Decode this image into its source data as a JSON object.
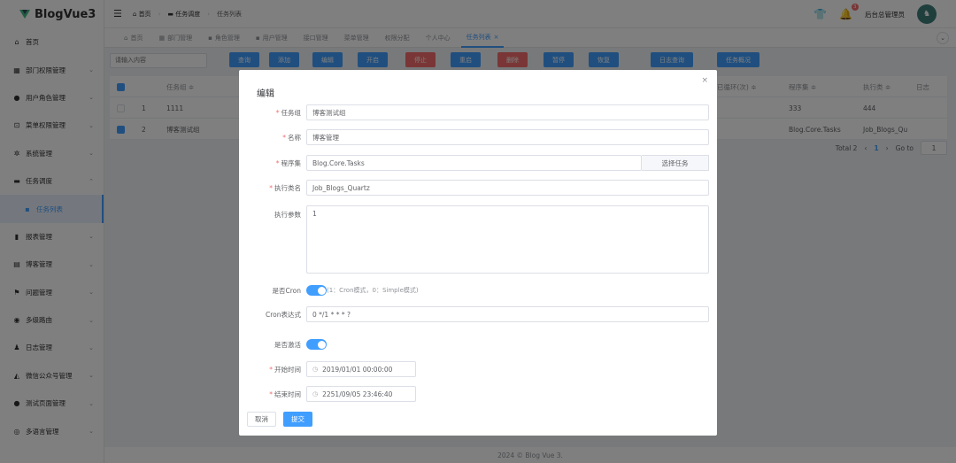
{
  "app": {
    "name": "BlogVue3"
  },
  "sidebar": {
    "items": [
      {
        "icon": "home-icon",
        "glyph": "⌂",
        "label": "首页",
        "chevron": ""
      },
      {
        "icon": "department-icon",
        "glyph": "▦",
        "label": "部门权限管理",
        "chevron": "⌄"
      },
      {
        "icon": "user-icon",
        "glyph": "●",
        "label": "用户角色管理",
        "chevron": "⌄"
      },
      {
        "icon": "lock-icon",
        "glyph": "⊡",
        "label": "菜单权限管理",
        "chevron": "⌄"
      },
      {
        "icon": "gear-icon",
        "glyph": "✲",
        "label": "系统管理",
        "chevron": "⌄"
      },
      {
        "icon": "task-icon",
        "glyph": "▬",
        "label": "任务调度",
        "chevron": "⌃"
      },
      {
        "icon": "grid-icon",
        "glyph": "▪",
        "label": "任务列表",
        "chevron": "",
        "sub": true
      },
      {
        "icon": "bar-chart-icon",
        "glyph": "▮",
        "label": "报表管理",
        "chevron": "⌄"
      },
      {
        "icon": "blog-icon",
        "glyph": "▤",
        "label": "博客管理",
        "chevron": "⌄"
      },
      {
        "icon": "flag-icon",
        "glyph": "⚑",
        "label": "问题管理",
        "chevron": "⌄"
      },
      {
        "icon": "route-icon",
        "glyph": "◉",
        "label": "多级路由",
        "chevron": "⌄"
      },
      {
        "icon": "log-icon",
        "glyph": "♟",
        "label": "日志管理",
        "chevron": "⌄"
      },
      {
        "icon": "wechat-icon",
        "glyph": "◭",
        "label": "微信公众号管理",
        "chevron": "⌄"
      },
      {
        "icon": "info-icon",
        "glyph": "●",
        "label": "测试页面管理",
        "chevron": "⌄"
      },
      {
        "icon": "language-icon",
        "glyph": "◎",
        "label": "多语言管理",
        "chevron": "⌄"
      }
    ]
  },
  "header": {
    "breadcrumb": [
      {
        "glyph": "⌂",
        "label": "首页"
      },
      {
        "glyph": "▬",
        "label": "任务调度"
      },
      {
        "glyph": "",
        "label": "任务列表"
      }
    ],
    "separator": "›",
    "notification_count": "3",
    "user_name": "后台总管理员"
  },
  "tabs": [
    {
      "glyph": "⌂",
      "label": "首页"
    },
    {
      "glyph": "▦",
      "label": "部门管理"
    },
    {
      "glyph": "▪",
      "label": "角色管理"
    },
    {
      "glyph": "▪",
      "label": "用户管理"
    },
    {
      "glyph": "",
      "label": "接口管理"
    },
    {
      "glyph": "",
      "label": "菜单管理"
    },
    {
      "glyph": "",
      "label": "权限分配"
    },
    {
      "glyph": "",
      "label": "个人中心"
    },
    {
      "glyph": "",
      "label": "任务列表",
      "active": true,
      "close": "×"
    }
  ],
  "toolbar": {
    "search_placeholder": "请输入内容",
    "buttons": [
      {
        "name": "query",
        "label": "查询",
        "color": "#409eff"
      },
      {
        "name": "add",
        "label": "添加",
        "color": "#409eff"
      },
      {
        "name": "edit",
        "label": "编辑",
        "color": "#409eff"
      },
      {
        "name": "start",
        "label": "开启",
        "color": "#409eff"
      },
      {
        "name": "stop",
        "label": "停止",
        "color": "#f56c6c"
      },
      {
        "name": "restart",
        "label": "重启",
        "color": "#409eff"
      },
      {
        "name": "delete",
        "label": "删除",
        "color": "#f56c6c"
      },
      {
        "name": "pause",
        "label": "暂停",
        "color": "#409eff"
      },
      {
        "name": "resume",
        "label": "恢复",
        "color": "#409eff"
      },
      {
        "name": "log-query",
        "label": "日志查询",
        "color": "#409eff"
      },
      {
        "name": "task-overview",
        "label": "任务概况",
        "color": "#409eff"
      }
    ]
  },
  "table": {
    "columns": [
      "任务组 ≑",
      "已循环(次) ≑",
      "程序集 ≑",
      "执行类 ≑",
      "日志"
    ],
    "rows": [
      {
        "index": "1",
        "group": "1111",
        "assembly": "333",
        "class": "444",
        "checked": false
      },
      {
        "index": "2",
        "group": "博客测试组",
        "assembly": "Blog.Core.Tasks",
        "class": "Job_Blogs_Qu",
        "checked": true
      }
    ],
    "pagination": {
      "total": "Total 2",
      "prev": "‹",
      "page": "1",
      "next": "›",
      "goto_label": "Go to",
      "goto_value": "1"
    }
  },
  "footer": {
    "text": "2024 © Blog Vue 3."
  },
  "dialog": {
    "title": "编辑",
    "close": "×",
    "fields": {
      "task_group": {
        "label": "任务组",
        "value": "博客测试组"
      },
      "name": {
        "label": "名称",
        "value": "博客管理"
      },
      "assembly": {
        "label": "程序集",
        "value": "Blog.Core.Tasks",
        "button": "选择任务"
      },
      "class_name": {
        "label": "执行类名",
        "value": "Job_Blogs_Quartz"
      },
      "params": {
        "label": "执行参数",
        "value": "1"
      },
      "is_cron": {
        "label": "是否Cron",
        "hint": "(1：Cron模式，0：Simple模式)"
      },
      "cron_expr": {
        "label": "Cron表达式",
        "value": "0 */1 * * * ?"
      },
      "is_active": {
        "label": "是否激活"
      },
      "start_time": {
        "label": "开始时间",
        "value": "2019/01/01 00:00:00"
      },
      "end_time": {
        "label": "结束时间",
        "value": "2251/09/05 23:46:40"
      }
    },
    "required_mark": "*",
    "cancel_label": "取消",
    "submit_label": "提交"
  }
}
